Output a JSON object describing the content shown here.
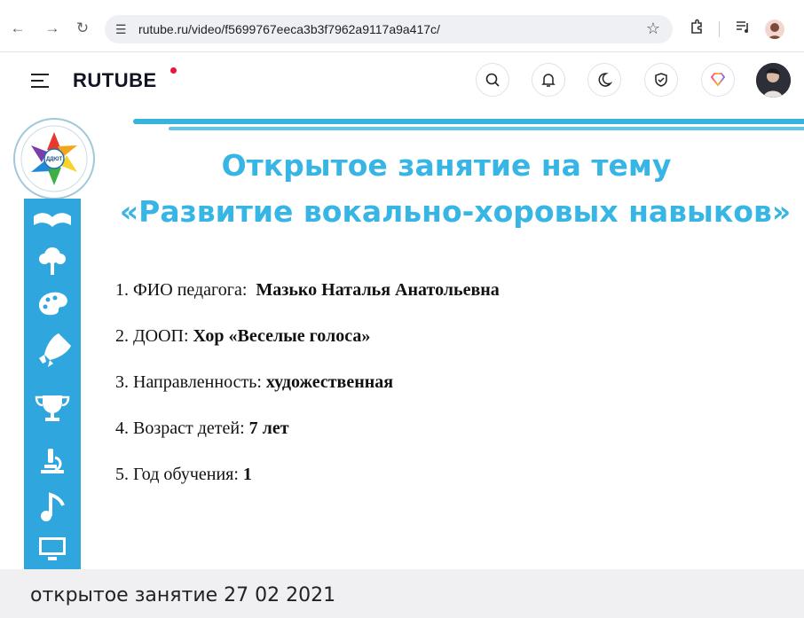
{
  "browser": {
    "url": "rutube.ru/video/f5699767eeca3b3f7962a9117a9a417c/",
    "icons": [
      "back-icon",
      "forward-icon",
      "reload-icon",
      "site-settings-icon",
      "bookmark-star-icon",
      "extensions-icon",
      "reading-list-icon",
      "profile-avatar"
    ]
  },
  "header": {
    "logo": "RUTUBE",
    "buttons": [
      "search-icon",
      "bell-icon",
      "moon-icon",
      "shield-check-icon",
      "premium-diamond-icon"
    ],
    "accent": "#ed143b"
  },
  "slide": {
    "title_line1": "Открытое занятие на тему",
    "title_line2": "«Развитие вокально-хоровых навыков»",
    "title_color": "#37b5e4",
    "items": [
      {
        "num": "1.",
        "label": "ФИО педагога:",
        "value": "Мазько Наталья Анатольевна"
      },
      {
        "num": "2.",
        "label": "ДООП:",
        "value": "Хор «Веселые голоса»"
      },
      {
        "num": "3.",
        "label": "Направленность:",
        "value": "художественная"
      },
      {
        "num": "4.",
        "label": "Возраст детей:",
        "value": "7 лет"
      },
      {
        "num": "5.",
        "label": "Год обучения:",
        "value": "1"
      }
    ]
  },
  "video_title": "открытое занятие 27 02 2021"
}
